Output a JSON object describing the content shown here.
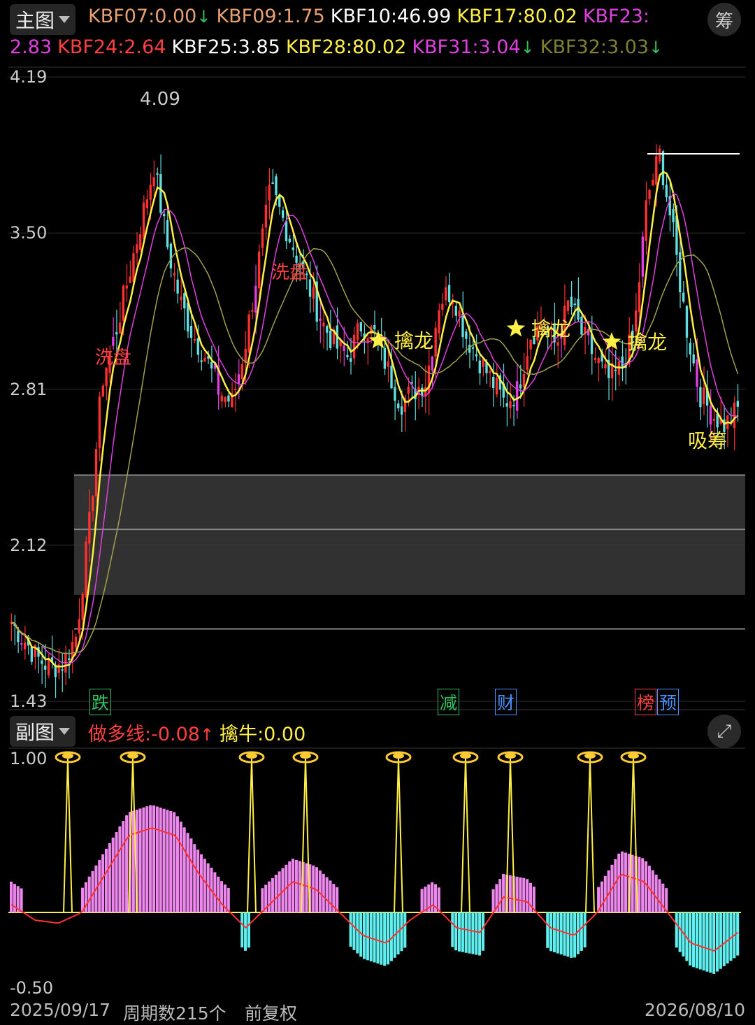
{
  "main": {
    "mode_label": "主图",
    "chip_label": "筹",
    "indicators_row1": [
      {
        "name": "KBF07",
        "value": "0.00",
        "color": "#e8a070",
        "arrow": "↓",
        "arrow_color": "#30c060"
      },
      {
        "name": "KBF09",
        "value": "1.75",
        "color": "#e8a070",
        "arrow": "",
        "arrow_color": ""
      },
      {
        "name": "KBF10",
        "value": "46.99",
        "color": "#ffffff",
        "arrow": "",
        "arrow_color": ""
      },
      {
        "name": "KBF17",
        "value": "80.02",
        "color": "#ffee44",
        "arrow": "",
        "arrow_color": ""
      },
      {
        "name": "KBF23",
        "value": "",
        "color": "#e040e0",
        "arrow": "",
        "arrow_color": ""
      }
    ],
    "indicators_row2": [
      {
        "name": "",
        "value": "2.83",
        "color": "#e040e0",
        "arrow": "",
        "arrow_color": ""
      },
      {
        "name": "KBF24",
        "value": "2.64",
        "color": "#ff4040",
        "arrow": "",
        "arrow_color": ""
      },
      {
        "name": "KBF25",
        "value": "3.85",
        "color": "#ffffff",
        "arrow": "",
        "arrow_color": ""
      },
      {
        "name": "KBF28",
        "value": "80.02",
        "color": "#ffee44",
        "arrow": "",
        "arrow_color": ""
      },
      {
        "name": "KBF31",
        "value": "3.04",
        "color": "#e040e0",
        "arrow": "↓",
        "arrow_color": "#30c060"
      },
      {
        "name": "KBF32",
        "value": "3.03",
        "color": "#808030",
        "arrow": "↓",
        "arrow_color": "#30c060"
      }
    ],
    "y_labels": [
      "4.19",
      "3.50",
      "2.81",
      "2.12",
      "1.43"
    ],
    "peak_label": "4.09",
    "annotations": [
      "洗盘",
      "洗盘",
      "擒龙",
      "擒龙",
      "擒龙",
      "吸筹"
    ],
    "event_tags": [
      {
        "text": "跌",
        "color": "#30c060"
      },
      {
        "text": "减",
        "color": "#30c060"
      },
      {
        "text": "财",
        "color": "#4a90ff"
      },
      {
        "text": "榜",
        "color": "#ff4040"
      },
      {
        "text": "预",
        "color": "#4a90ff"
      }
    ]
  },
  "sub": {
    "mode_label": "副图",
    "indicators": [
      {
        "name": "做多线",
        "value": "-0.08",
        "color": "#ff4040",
        "arrow": "↑",
        "arrow_color": "#ff4040"
      },
      {
        "name": "擒牛",
        "value": "0.00",
        "color": "#ffee44",
        "arrow": "",
        "arrow_color": ""
      }
    ],
    "y_labels": [
      "1.00",
      "-0.50"
    ]
  },
  "footer": {
    "start_date": "2025/09/17",
    "period_count": "周期数215个",
    "adjust": "前复权",
    "end_date": "2026/08/10"
  },
  "chart_data": [
    {
      "type": "candlestick",
      "ylim": [
        1.43,
        4.19
      ],
      "y_ticks": [
        4.19,
        3.5,
        2.81,
        2.12,
        1.43
      ],
      "x_range": [
        "2025/09/17",
        "2026/08/10"
      ],
      "bars": 215,
      "peak": 4.09,
      "close_profile": [
        1.78,
        1.7,
        1.62,
        1.58,
        1.6,
        1.72,
        2.2,
        2.85,
        3.05,
        3.3,
        3.55,
        3.8,
        3.45,
        3.2,
        3.05,
        2.95,
        2.8,
        2.75,
        3.0,
        3.35,
        3.7,
        3.55,
        3.4,
        3.25,
        3.1,
        3.0,
        2.95,
        3.1,
        3.05,
        2.9,
        2.75,
        2.8,
        2.85,
        3.2,
        3.25,
        3.05,
        2.95,
        2.85,
        2.75,
        2.8,
        3.05,
        3.1,
        3.0,
        3.2,
        3.05,
        2.95,
        2.85,
        2.9,
        3.05,
        3.65,
        3.85,
        3.5,
        3.1,
        2.8,
        2.7,
        2.65,
        2.72
      ]
    },
    {
      "type": "bar",
      "ylim": [
        -0.5,
        1.0
      ],
      "signals": 9,
      "series": [
        {
          "name": "做多线",
          "values": [
            0.1,
            0.0,
            -0.02,
            0.05,
            0.3,
            0.55,
            0.6,
            0.55,
            0.3,
            0.1,
            -0.05,
            0.1,
            0.25,
            0.2,
            0.05,
            -0.1,
            -0.15,
            0.0,
            0.1,
            -0.05,
            -0.08,
            0.15,
            0.12,
            -0.05,
            -0.1,
            0.05,
            0.3,
            0.25,
            0.05,
            -0.15,
            -0.2,
            -0.08
          ]
        },
        {
          "name": "擒牛",
          "values": [
            0.0,
            0.0,
            0.0,
            0.0,
            0.0,
            0.0,
            0.0,
            0.0,
            0.0
          ]
        }
      ]
    }
  ]
}
